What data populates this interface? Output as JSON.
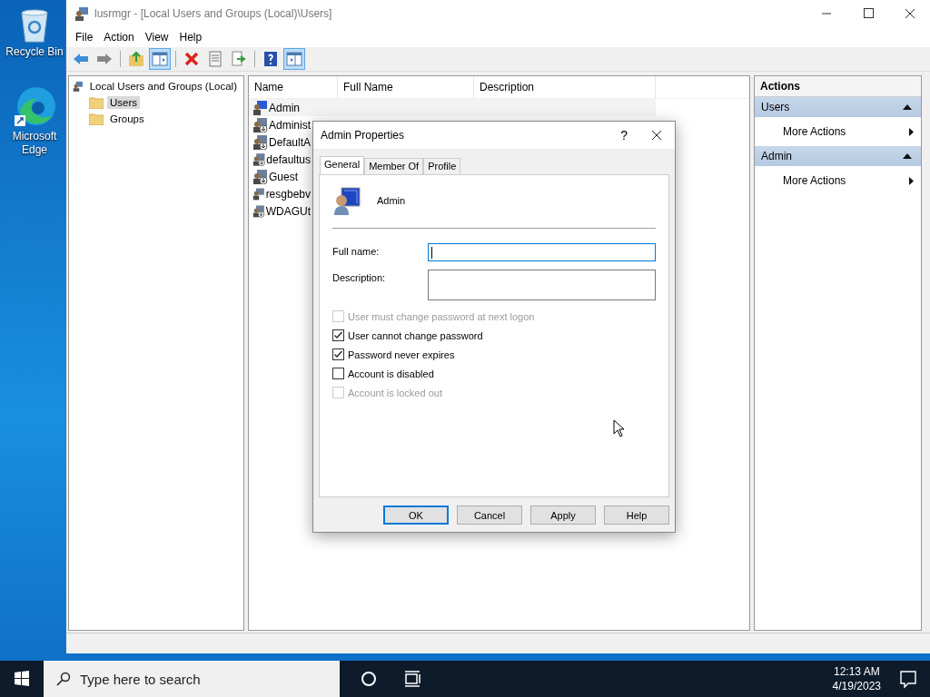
{
  "desktop_icons": [
    {
      "label": "Recycle Bin",
      "kind": "recycle"
    },
    {
      "label": "Microsoft Edge",
      "kind": "edge"
    }
  ],
  "window": {
    "title": "lusrmgr - [Local Users and Groups (Local)\\Users]"
  },
  "menu": [
    "File",
    "Action",
    "View",
    "Help"
  ],
  "toolbar": [
    {
      "kind": "back",
      "pressed": false
    },
    {
      "kind": "forward",
      "pressed": false
    },
    {
      "kind": "sep"
    },
    {
      "kind": "up",
      "pressed": false
    },
    {
      "kind": "tree",
      "pressed": true
    },
    {
      "kind": "sep"
    },
    {
      "kind": "delete",
      "pressed": false
    },
    {
      "kind": "properties",
      "pressed": false
    },
    {
      "kind": "export",
      "pressed": false
    },
    {
      "kind": "sep"
    },
    {
      "kind": "help",
      "pressed": false
    },
    {
      "kind": "actionpane",
      "pressed": true
    }
  ],
  "tree": {
    "label": "Local Users and Groups (Local)",
    "children": [
      {
        "label": "Users",
        "selected": true
      },
      {
        "label": "Groups",
        "selected": false
      }
    ]
  },
  "list": {
    "columns": [
      "Name",
      "Full Name",
      "Description"
    ],
    "rows": [
      {
        "name": "Admin",
        "selected": true,
        "disabled": false
      },
      {
        "name": "Administ",
        "selected": false,
        "disabled": true
      },
      {
        "name": "DefaultA",
        "selected": false,
        "disabled": true
      },
      {
        "name": "defaultus",
        "selected": false,
        "disabled": true
      },
      {
        "name": "Guest",
        "selected": false,
        "disabled": true
      },
      {
        "name": "resgbebv",
        "selected": false,
        "disabled": false
      },
      {
        "name": "WDAGUt",
        "selected": false,
        "disabled": true
      }
    ]
  },
  "actions": {
    "title": "Actions",
    "sections": [
      {
        "title": "Users",
        "expanded": true,
        "items": [
          "More Actions"
        ]
      },
      {
        "title": "Admin",
        "expanded": true,
        "items": [
          "More Actions"
        ]
      }
    ]
  },
  "dialog": {
    "title": "Admin Properties",
    "help": "?",
    "tabs": [
      {
        "label": "General",
        "selected": true
      },
      {
        "label": "Member Of",
        "selected": false
      },
      {
        "label": "Profile",
        "selected": false
      }
    ],
    "user": "Admin",
    "fields": [
      {
        "label": "Full name:",
        "focused": true,
        "kind": "line"
      },
      {
        "label": "Description:",
        "focused": false,
        "kind": "tall"
      }
    ],
    "checkboxes": [
      {
        "label": "User must change password at next logon",
        "checked": false,
        "disabled": true
      },
      {
        "label": "User cannot change password",
        "checked": true,
        "disabled": false
      },
      {
        "label": "Password never expires",
        "checked": true,
        "disabled": false
      },
      {
        "label": "Account is disabled",
        "checked": false,
        "disabled": false
      },
      {
        "label": "Account is locked out",
        "checked": false,
        "disabled": true
      }
    ],
    "buttons": [
      {
        "label": "OK",
        "default": true
      },
      {
        "label": "Cancel",
        "default": false
      },
      {
        "label": "Apply",
        "default": false
      },
      {
        "label": "Help",
        "default": false
      }
    ]
  },
  "taskbar": {
    "search_placeholder": "Type here to search",
    "time": "12:13 AM",
    "date": "4/19/2023"
  }
}
